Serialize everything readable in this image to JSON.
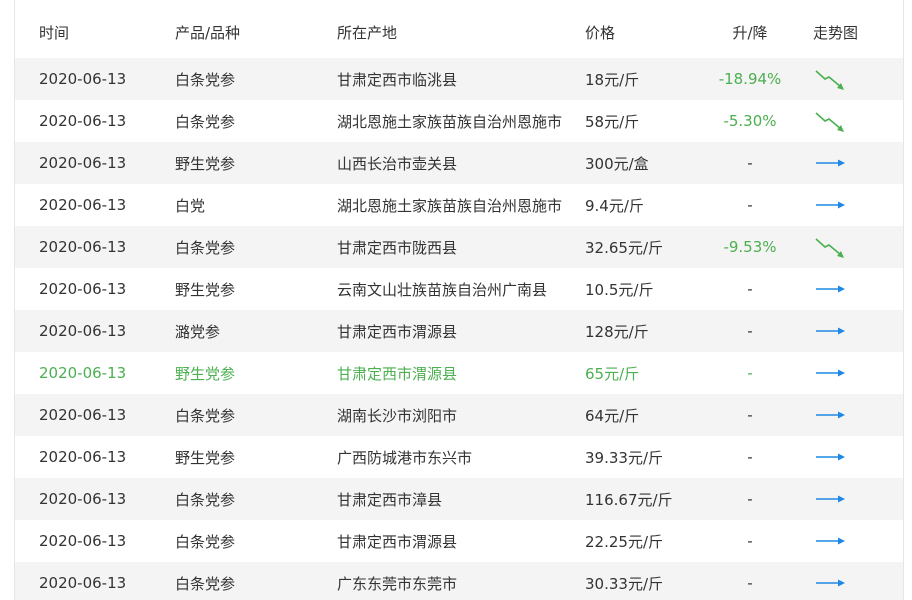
{
  "headers": {
    "date": "时间",
    "product": "产品/品种",
    "place": "所在产地",
    "price": "价格",
    "change": "升/降",
    "trend": "走势图"
  },
  "rows": [
    {
      "date": "2020-06-13",
      "product": "白条党参",
      "place": "甘肃定西市临洮县",
      "price": "18元/斤",
      "change": "-18.94%",
      "trend": "down-arrow-icon"
    },
    {
      "date": "2020-06-13",
      "product": "白条党参",
      "place": "湖北恩施土家族苗族自治州恩施市",
      "price": "58元/斤",
      "change": "-5.30%",
      "trend": "down-arrow-icon"
    },
    {
      "date": "2020-06-13",
      "product": "野生党参",
      "place": "山西长治市壶关县",
      "price": "300元/盒",
      "change": "-",
      "trend": "flat-arrow-icon"
    },
    {
      "date": "2020-06-13",
      "product": "白党",
      "place": "湖北恩施土家族苗族自治州恩施市",
      "price": "9.4元/斤",
      "change": "-",
      "trend": "flat-arrow-icon"
    },
    {
      "date": "2020-06-13",
      "product": "白条党参",
      "place": "甘肃定西市陇西县",
      "price": "32.65元/斤",
      "change": "-9.53%",
      "trend": "down-arrow-icon"
    },
    {
      "date": "2020-06-13",
      "product": "野生党参",
      "place": "云南文山壮族苗族自治州广南县",
      "price": "10.5元/斤",
      "change": "-",
      "trend": "flat-arrow-icon"
    },
    {
      "date": "2020-06-13",
      "product": "潞党参",
      "place": "甘肃定西市渭源县",
      "price": "128元/斤",
      "change": "-",
      "trend": "flat-arrow-icon"
    },
    {
      "date": "2020-06-13",
      "product": "野生党参",
      "place": "甘肃定西市渭源县",
      "price": "65元/斤",
      "change": "-",
      "trend": "flat-arrow-icon",
      "highlighted": true
    },
    {
      "date": "2020-06-13",
      "product": "白条党参",
      "place": "湖南长沙市浏阳市",
      "price": "64元/斤",
      "change": "-",
      "trend": "flat-arrow-icon"
    },
    {
      "date": "2020-06-13",
      "product": "野生党参",
      "place": "广西防城港市东兴市",
      "price": "39.33元/斤",
      "change": "-",
      "trend": "flat-arrow-icon"
    },
    {
      "date": "2020-06-13",
      "product": "白条党参",
      "place": "甘肃定西市漳县",
      "price": "116.67元/斤",
      "change": "-",
      "trend": "flat-arrow-icon"
    },
    {
      "date": "2020-06-13",
      "product": "白条党参",
      "place": "甘肃定西市渭源县",
      "price": "22.25元/斤",
      "change": "-",
      "trend": "flat-arrow-icon"
    },
    {
      "date": "2020-06-13",
      "product": "白条党参",
      "place": "广东东莞市东莞市",
      "price": "30.33元/斤",
      "change": "-",
      "trend": "flat-arrow-icon"
    }
  ],
  "colors": {
    "down": "#4caf50",
    "flat": "#1e88e5",
    "highlight": "#4caf50",
    "alt_row": "#f4f4f4"
  }
}
